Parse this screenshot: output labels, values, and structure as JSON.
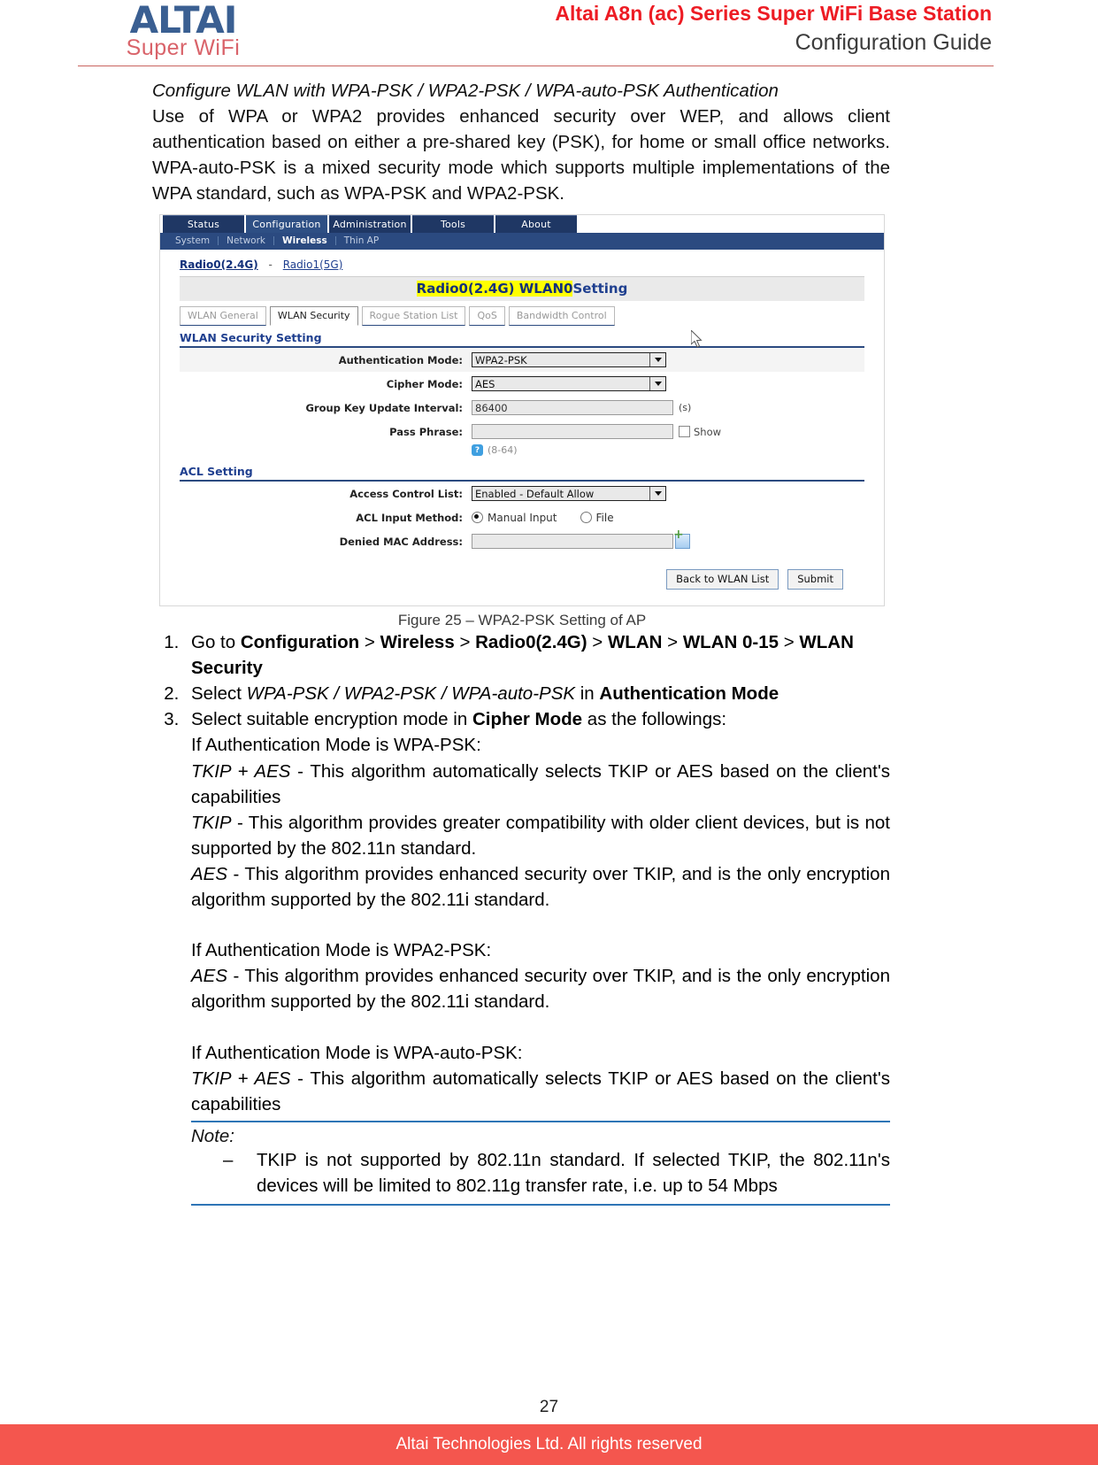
{
  "header": {
    "logo_word": "ALTAI",
    "logo_sub": "Super WiFi",
    "title_line1": "Altai A8n (ac) Series Super WiFi Base Station",
    "title_line2": "Configuration Guide",
    "brand_red": "#ed1c24",
    "brand_blue": "#3a5f92",
    "logo_sub_color": "#d9636a"
  },
  "intro": {
    "heading": "Configure WLAN with WPA-PSK / WPA2-PSK / WPA-auto-PSK Authentication",
    "body": "Use of WPA or WPA2 provides enhanced security over WEP, and allows client authentication based on either a pre-shared key (PSK), for home or small office networks. WPA-auto-PSK is a mixed security mode which supports multiple implementations of the WPA standard, such as WPA-PSK and WPA2-PSK."
  },
  "app": {
    "main_tabs": [
      {
        "label": "Status",
        "active": false
      },
      {
        "label": "Configuration",
        "active": true
      },
      {
        "label": "Administration",
        "active": false
      },
      {
        "label": "Tools",
        "active": false
      },
      {
        "label": "About",
        "active": false
      }
    ],
    "sub_nav": [
      {
        "label": "System",
        "active": false
      },
      {
        "label": "Network",
        "active": false
      },
      {
        "label": "Wireless",
        "active": true
      },
      {
        "label": "Thin AP",
        "active": false
      }
    ],
    "radio_links": {
      "radio0": "Radio0(2.4G)",
      "separator": "-",
      "radio1": "Radio1(5G)"
    },
    "panel_title_highlight": "Radio0(2.4G) WLAN0",
    "panel_title_rest": "Setting",
    "sub_tabs": [
      {
        "label": "WLAN General",
        "active": false
      },
      {
        "label": "WLAN Security",
        "active": true
      },
      {
        "label": "Rogue Station List",
        "active": false
      },
      {
        "label": "QoS",
        "active": false
      },
      {
        "label": "Bandwidth Control",
        "active": false
      }
    ],
    "security_section_title": "WLAN Security Setting",
    "fields": {
      "auth_mode_label": "Authentication Mode:",
      "auth_mode_value": "WPA2-PSK",
      "cipher_mode_label": "Cipher Mode:",
      "cipher_mode_value": "AES",
      "group_key_label": "Group Key Update Interval:",
      "group_key_value": "86400",
      "group_key_unit": "(s)",
      "pass_phrase_label": "Pass Phrase:",
      "pass_phrase_value": "",
      "show_label": "Show",
      "hint_icon": "?",
      "hint_text": "(8-64)"
    },
    "acl_section_title": "ACL Setting",
    "acl": {
      "access_control_label": "Access Control List:",
      "access_control_value": "Enabled - Default Allow",
      "input_method_label": "ACL Input Method:",
      "input_option_manual": "Manual Input",
      "input_option_file": "File",
      "denied_mac_label": "Denied MAC Address:",
      "denied_mac_value": ""
    },
    "buttons": {
      "back": "Back to WLAN List",
      "submit": "Submit"
    }
  },
  "figure_caption": "Figure 25 – WPA2-PSK Setting of AP",
  "steps": {
    "step1": {
      "prefix": "Go to ",
      "b1": "Configuration",
      "s1": " > ",
      "b2": "Wireless",
      "s2": " > ",
      "b3": "Radio0(2.4G)",
      "s3": " > ",
      "b4": "WLAN",
      "s4": " > ",
      "b5": "WLAN 0-15",
      "s5": " > ",
      "b6": "WLAN Security"
    },
    "step2": {
      "prefix": "Select ",
      "i1": "WPA-PSK / WPA2-PSK / WPA-auto-PSK",
      "mid": " in ",
      "b1": "Authentication Mode"
    },
    "step3": {
      "prefix": "Select suitable encryption mode in ",
      "b1": "Cipher Mode",
      "suffix": " as the followings:"
    }
  },
  "cipher_details": {
    "wpa_psk_heading": "If Authentication Mode is WPA-PSK:",
    "wpa_psk_items": [
      {
        "term": "TKIP + AES",
        "text": " - This algorithm automatically selects TKIP or AES based on the client's capabilities"
      },
      {
        "term": "TKIP",
        "text": " - This algorithm provides greater compatibility with older client devices, but is not supported by the 802.11n standard."
      },
      {
        "term": "AES",
        "text": " - This algorithm provides enhanced security over TKIP, and is the only encryption algorithm supported by the 802.11i standard."
      }
    ],
    "wpa2_psk_heading": "If Authentication Mode is WPA2-PSK:",
    "wpa2_psk_items": [
      {
        "term": "AES",
        "text": " - This algorithm provides enhanced security over TKIP, and is the only encryption algorithm supported by the 802.11i standard."
      }
    ],
    "wpa_auto_psk_heading": "If Authentication Mode is WPA-auto-PSK:",
    "wpa_auto_psk_items": [
      {
        "term": "TKIP + AES",
        "text": " - This algorithm automatically selects TKIP or AES based on the client's capabilities"
      }
    ]
  },
  "note": {
    "title": "Note:",
    "items": [
      "TKIP is not supported by 802.11n standard. If selected TKIP, the 802.11n's devices will be limited to 802.11g transfer rate, i.e. up to 54 Mbps"
    ]
  },
  "footer": {
    "page_number": "27",
    "copyright": "Altai Technologies Ltd. All rights reserved",
    "bar_color": "#f4564e"
  }
}
